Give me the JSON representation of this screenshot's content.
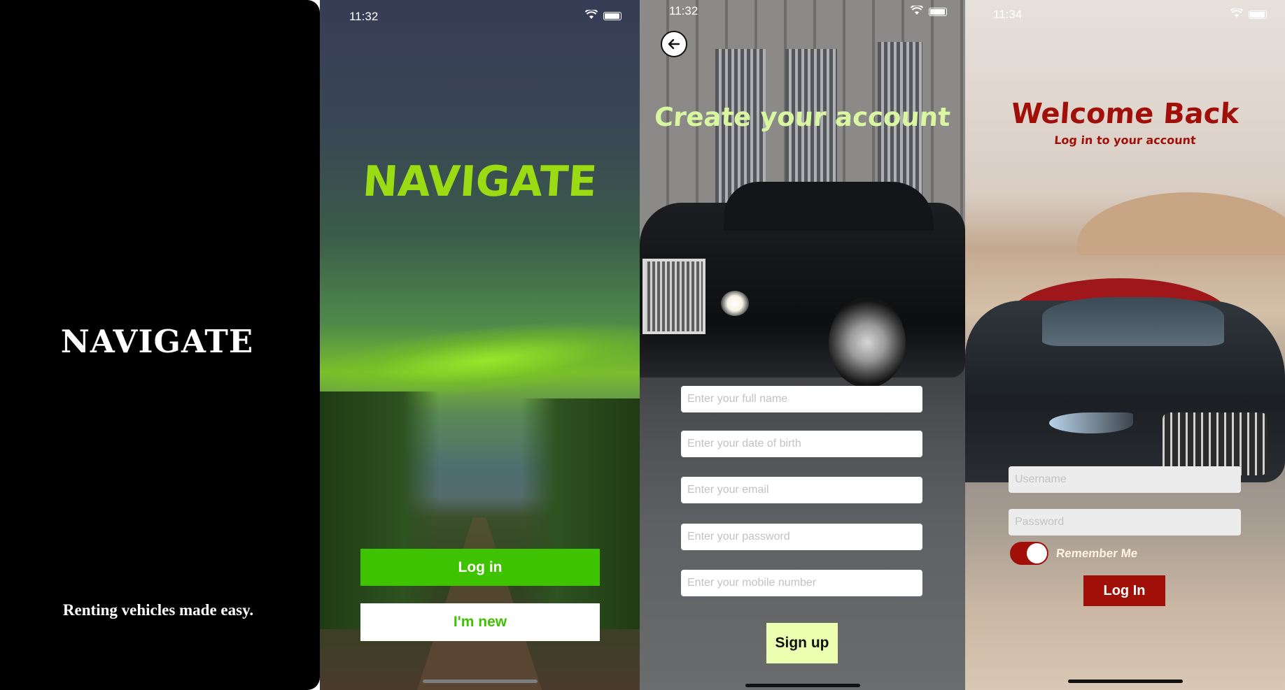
{
  "panels": {
    "splash": {
      "brand": "NAVIGATE",
      "tagline": "Renting vehicles made easy."
    },
    "home": {
      "time": "11:32",
      "brand": "NAVIGATE",
      "login_button": "Log in",
      "new_button": "I'm new"
    },
    "signup": {
      "time": "11:32",
      "title": "Create your account",
      "fields": [
        {
          "placeholder": "Enter your full name"
        },
        {
          "placeholder": "Enter your date of birth"
        },
        {
          "placeholder": "Enter your email"
        },
        {
          "placeholder": "Enter your password"
        },
        {
          "placeholder": "Enter your mobile number"
        }
      ],
      "signup_button": "Sign up"
    },
    "login": {
      "time": "11:34",
      "title": "Welcome Back",
      "subtitle": "Log in to your account",
      "username_placeholder": "Username",
      "password_placeholder": "Password",
      "remember_label": "Remember Me",
      "remember_on": true,
      "login_button": "Log In"
    }
  },
  "colors": {
    "accent_green": "#3fc200",
    "brand_lime": "#9bdb13",
    "signup_title": "#d8f7a0",
    "signup_button_bg": "#ecffb0",
    "maroon": "#a00f08"
  },
  "icons": [
    "wifi-icon",
    "battery-icon",
    "back-arrow-icon"
  ]
}
